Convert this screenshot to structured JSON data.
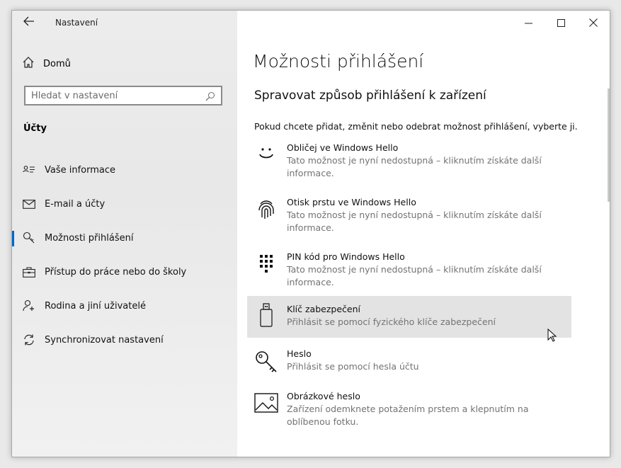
{
  "window": {
    "title": "Nastavení"
  },
  "sidebar": {
    "home_label": "Domů",
    "search_placeholder": "Hledat v nastavení",
    "section_heading": "Účty",
    "items": [
      {
        "label": "Vaše informace",
        "icon": "user-card-icon"
      },
      {
        "label": "E-mail a účty",
        "icon": "mail-icon"
      },
      {
        "label": "Možnosti přihlášení",
        "icon": "key-icon",
        "active": true
      },
      {
        "label": "Přístup do práce nebo do školy",
        "icon": "briefcase-icon"
      },
      {
        "label": "Rodina a jiní uživatelé",
        "icon": "add-user-icon"
      },
      {
        "label": "Synchronizovat nastavení",
        "icon": "sync-icon"
      }
    ]
  },
  "main": {
    "title": "Možnosti přihlášení",
    "subtitle": "Spravovat způsob přihlášení k zařízení",
    "intro": "Pokud chcete přidat, změnit nebo odebrat možnost přihlášení, vyberte ji.",
    "options": [
      {
        "name": "Obličej ve Windows Hello",
        "desc": "Tato možnost je nyní nedostupná – kliknutím získáte další informace.",
        "icon": "face-icon"
      },
      {
        "name": "Otisk prstu ve Windows Hello",
        "desc": "Tato možnost je nyní nedostupná – kliknutím získáte další informace.",
        "icon": "fingerprint-icon"
      },
      {
        "name": "PIN kód pro Windows Hello",
        "desc": "Tato možnost je nyní nedostupná – kliknutím získáte další informace.",
        "icon": "pin-keypad-icon"
      },
      {
        "name": "Klíč zabezpečení",
        "desc": "Přihlásit se pomocí fyzického klíče zabezpečení",
        "icon": "usb-key-icon",
        "hovered": true
      },
      {
        "name": "Heslo",
        "desc": "Přihlásit se pomocí hesla účtu",
        "icon": "password-key-icon"
      },
      {
        "name": "Obrázkové heslo",
        "desc": "Zařízení odemknete potažením prstem a klepnutím na oblíbenou fotku.",
        "icon": "picture-icon"
      }
    ]
  },
  "colors": {
    "accent": "#0066cc",
    "hover_bg": "#e3e3e3",
    "desc_text": "#737373"
  }
}
